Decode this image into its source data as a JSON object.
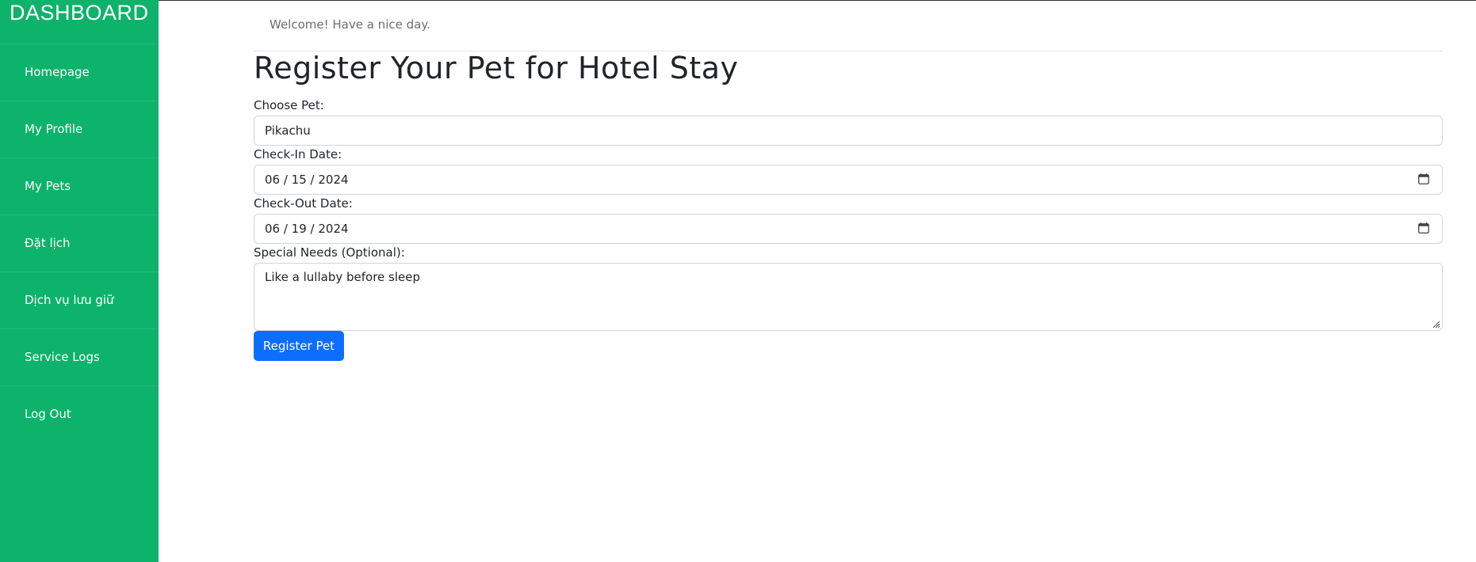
{
  "sidebar": {
    "brand": "DASHBOARD",
    "items": [
      {
        "label": "Homepage"
      },
      {
        "label": "My Profile"
      },
      {
        "label": "My Pets"
      },
      {
        "label": "Đặt lịch"
      },
      {
        "label": "Dịch vụ lưu giữ"
      },
      {
        "label": "Service Logs"
      },
      {
        "label": "Log Out"
      }
    ]
  },
  "header": {
    "welcome": "Welcome! Have a nice day."
  },
  "form": {
    "title": "Register Your Pet for Hotel Stay",
    "pet": {
      "label": "Choose Pet:",
      "value": "Pikachu"
    },
    "checkin": {
      "label": "Check-In Date:",
      "value": "06 / 15 / 2024"
    },
    "checkout": {
      "label": "Check-Out Date:",
      "value": "06 / 19 / 2024"
    },
    "special_needs": {
      "label": "Special Needs (Optional):",
      "value": "Like a lullaby before sleep"
    },
    "submit_label": "Register Pet"
  },
  "colors": {
    "sidebar_bg": "#0db26b",
    "primary_button": "#0d6efd"
  },
  "icons": {
    "date_picker": "calendar-icon",
    "resize": "resize-grip-icon"
  }
}
